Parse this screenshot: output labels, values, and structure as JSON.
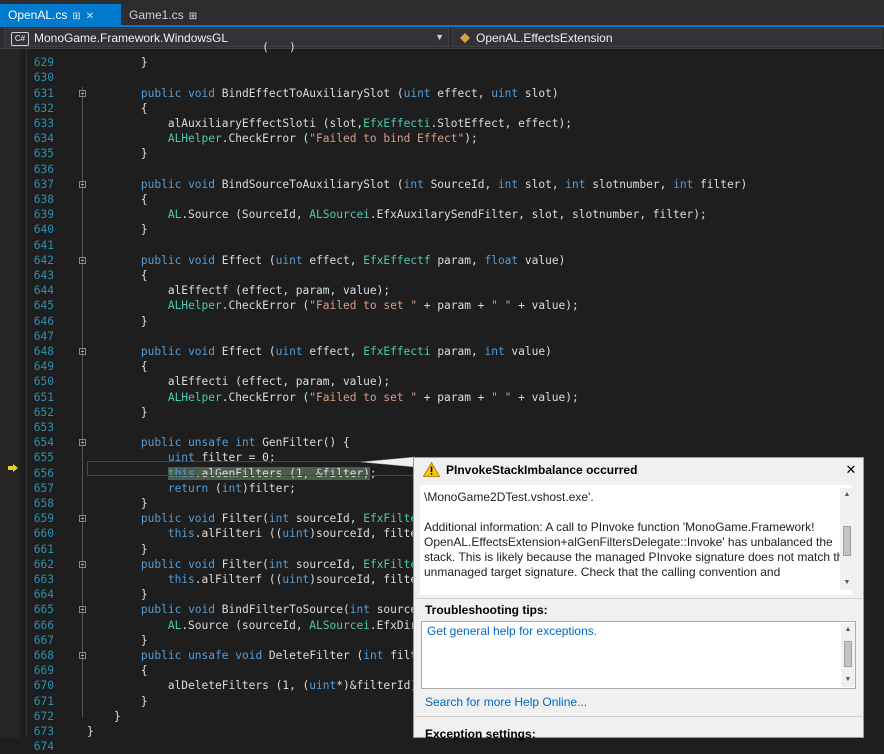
{
  "tabs": [
    {
      "label": "OpenAL.cs",
      "pin_icon": "⊞",
      "close_icon": "✕",
      "active": true
    },
    {
      "label": "Game1.cs",
      "pin_icon": "⊞",
      "active": false
    }
  ],
  "navbar": {
    "project": "MonoGame.Framework.WindowsGL",
    "project_badge": "C#",
    "member": "OpenAL.EffectsExtension"
  },
  "editor": {
    "current_line": 656,
    "lines": [
      {
        "n": "",
        "html": "<span style=\"color:#dcdcdc\">                          (   )           </span>"
      },
      {
        "n": "629",
        "html": "        }"
      },
      {
        "n": "630",
        "html": ""
      },
      {
        "n": "631",
        "fold": true,
        "html": "        <span class=kw>public</span> <span class=kw>void</span> BindEffectToAuxiliarySlot (<span class=kw>uint</span> effect, <span class=kw>uint</span> slot)"
      },
      {
        "n": "632",
        "html": "        {"
      },
      {
        "n": "633",
        "html": "            alAuxiliaryEffectSloti (slot,<span class=ty>EfxEffecti</span>.SlotEffect, effect);"
      },
      {
        "n": "634",
        "html": "            <span class=ty>ALHelper</span>.CheckError (<span class=st>\"Failed to bind Effect\"</span>);"
      },
      {
        "n": "635",
        "html": "        }"
      },
      {
        "n": "636",
        "html": ""
      },
      {
        "n": "637",
        "fold": true,
        "html": "        <span class=kw>public</span> <span class=kw>void</span> BindSourceToAuxiliarySlot (<span class=kw>int</span> SourceId, <span class=kw>int</span> slot, <span class=kw>int</span> slotnumber, <span class=kw>int</span> filter)"
      },
      {
        "n": "638",
        "html": "        {"
      },
      {
        "n": "639",
        "html": "            <span class=ty>AL</span>.Source (SourceId, <span class=ty>ALSourcei</span>.EfxAuxilarySendFilter, slot, slotnumber, filter);"
      },
      {
        "n": "640",
        "html": "        }"
      },
      {
        "n": "641",
        "html": ""
      },
      {
        "n": "642",
        "fold": true,
        "html": "        <span class=kw>public</span> <span class=kw>void</span> Effect (<span class=kw>uint</span> effect, <span class=ty>EfxEffectf</span> param, <span class=kw>float</span> value)"
      },
      {
        "n": "643",
        "html": "        {"
      },
      {
        "n": "644",
        "html": "            alEffectf (effect, param, value);"
      },
      {
        "n": "645",
        "html": "            <span class=ty>ALHelper</span>.CheckError (<span class=st>\"Failed to set \"</span> + param + <span class=st>\" \"</span> + value);"
      },
      {
        "n": "646",
        "html": "        }"
      },
      {
        "n": "647",
        "html": ""
      },
      {
        "n": "648",
        "fold": true,
        "html": "        <span class=kw>public</span> <span class=kw>void</span> Effect (<span class=kw>uint</span> effect, <span class=ty>EfxEffecti</span> param, <span class=kw>int</span> value)"
      },
      {
        "n": "649",
        "html": "        {"
      },
      {
        "n": "650",
        "html": "            alEffecti (effect, param, value);"
      },
      {
        "n": "651",
        "html": "            <span class=ty>ALHelper</span>.CheckError (<span class=st>\"Failed to set \"</span> + param + <span class=st>\" \"</span> + value);"
      },
      {
        "n": "652",
        "html": "        }"
      },
      {
        "n": "653",
        "html": ""
      },
      {
        "n": "654",
        "fold": true,
        "html": "        <span class=kw>public</span> <span class=kw>unsafe</span> <span class=kw>int</span> GenFilter() {"
      },
      {
        "n": "655",
        "html": "            <span class=kw>uint</span> filter = 0;"
      },
      {
        "n": "656",
        "html": "            <span class=hl><span class=kw>this</span>.alGenFilters (1, &amp;filter)</span>;"
      },
      {
        "n": "657",
        "html": "            <span class=kw>return</span> (<span class=kw>int</span>)filter;"
      },
      {
        "n": "658",
        "html": "        }"
      },
      {
        "n": "659",
        "fold": true,
        "html": "        <span class=kw>public</span> <span class=kw>void</span> Filter(<span class=kw>int</span> sourceId, <span class=ty>EfxFilteri</span>"
      },
      {
        "n": "660",
        "html": "            <span class=kw>this</span>.alFilteri ((<span class=kw>uint</span>)sourceId, filter,"
      },
      {
        "n": "661",
        "html": "        }"
      },
      {
        "n": "662",
        "fold": true,
        "html": "        <span class=kw>public</span> <span class=kw>void</span> Filter(<span class=kw>int</span> sourceId, <span class=ty>EfxFilterf</span>"
      },
      {
        "n": "663",
        "html": "            <span class=kw>this</span>.alFilterf ((<span class=kw>uint</span>)sourceId, filter,"
      },
      {
        "n": "664",
        "html": "        }"
      },
      {
        "n": "665",
        "fold": true,
        "html": "        <span class=kw>public</span> <span class=kw>void</span> BindFilterToSource(<span class=kw>int</span> sourceId"
      },
      {
        "n": "666",
        "html": "            <span class=ty>AL</span>.Source (sourceId, <span class=ty>ALSourcei</span>.EfxDirec"
      },
      {
        "n": "667",
        "html": "        }"
      },
      {
        "n": "668",
        "fold": true,
        "html": "        <span class=kw>public</span> <span class=kw>unsafe</span> <span class=kw>void</span> DeleteFilter (<span class=kw>int</span> filter"
      },
      {
        "n": "669",
        "html": "        {"
      },
      {
        "n": "670",
        "html": "            alDeleteFilters (1, (<span class=kw>uint</span>*)&amp;filterId);"
      },
      {
        "n": "671",
        "html": "        }"
      },
      {
        "n": "672",
        "html": "    }"
      },
      {
        "n": "673",
        "html": "}"
      },
      {
        "n": "674",
        "html": ""
      }
    ]
  },
  "exception": {
    "title": "PInvokeStackImbalance occurred",
    "message_line1": "\\MonoGame2DTest.vshost.exe'.",
    "message_line2": "Additional information: A call to PInvoke function 'MonoGame.Framework! OpenAL.EffectsExtension+alGenFiltersDelegate::Invoke' has unbalanced the stack. This is likely because the managed PInvoke signature does not match the unmanaged target signature. Check that the calling convention and",
    "tips_label": "Troubleshooting tips:",
    "tips_link": "Get general help for exceptions.",
    "help_link": "Search for more Help Online...",
    "settings_label": "Exception settings:"
  },
  "colors": {
    "accent": "#007acc",
    "editor_bg": "#1e1e1e",
    "keyword": "#569cd6",
    "type": "#4ec9b0",
    "string": "#d69d85",
    "line_number": "#2b91af"
  }
}
